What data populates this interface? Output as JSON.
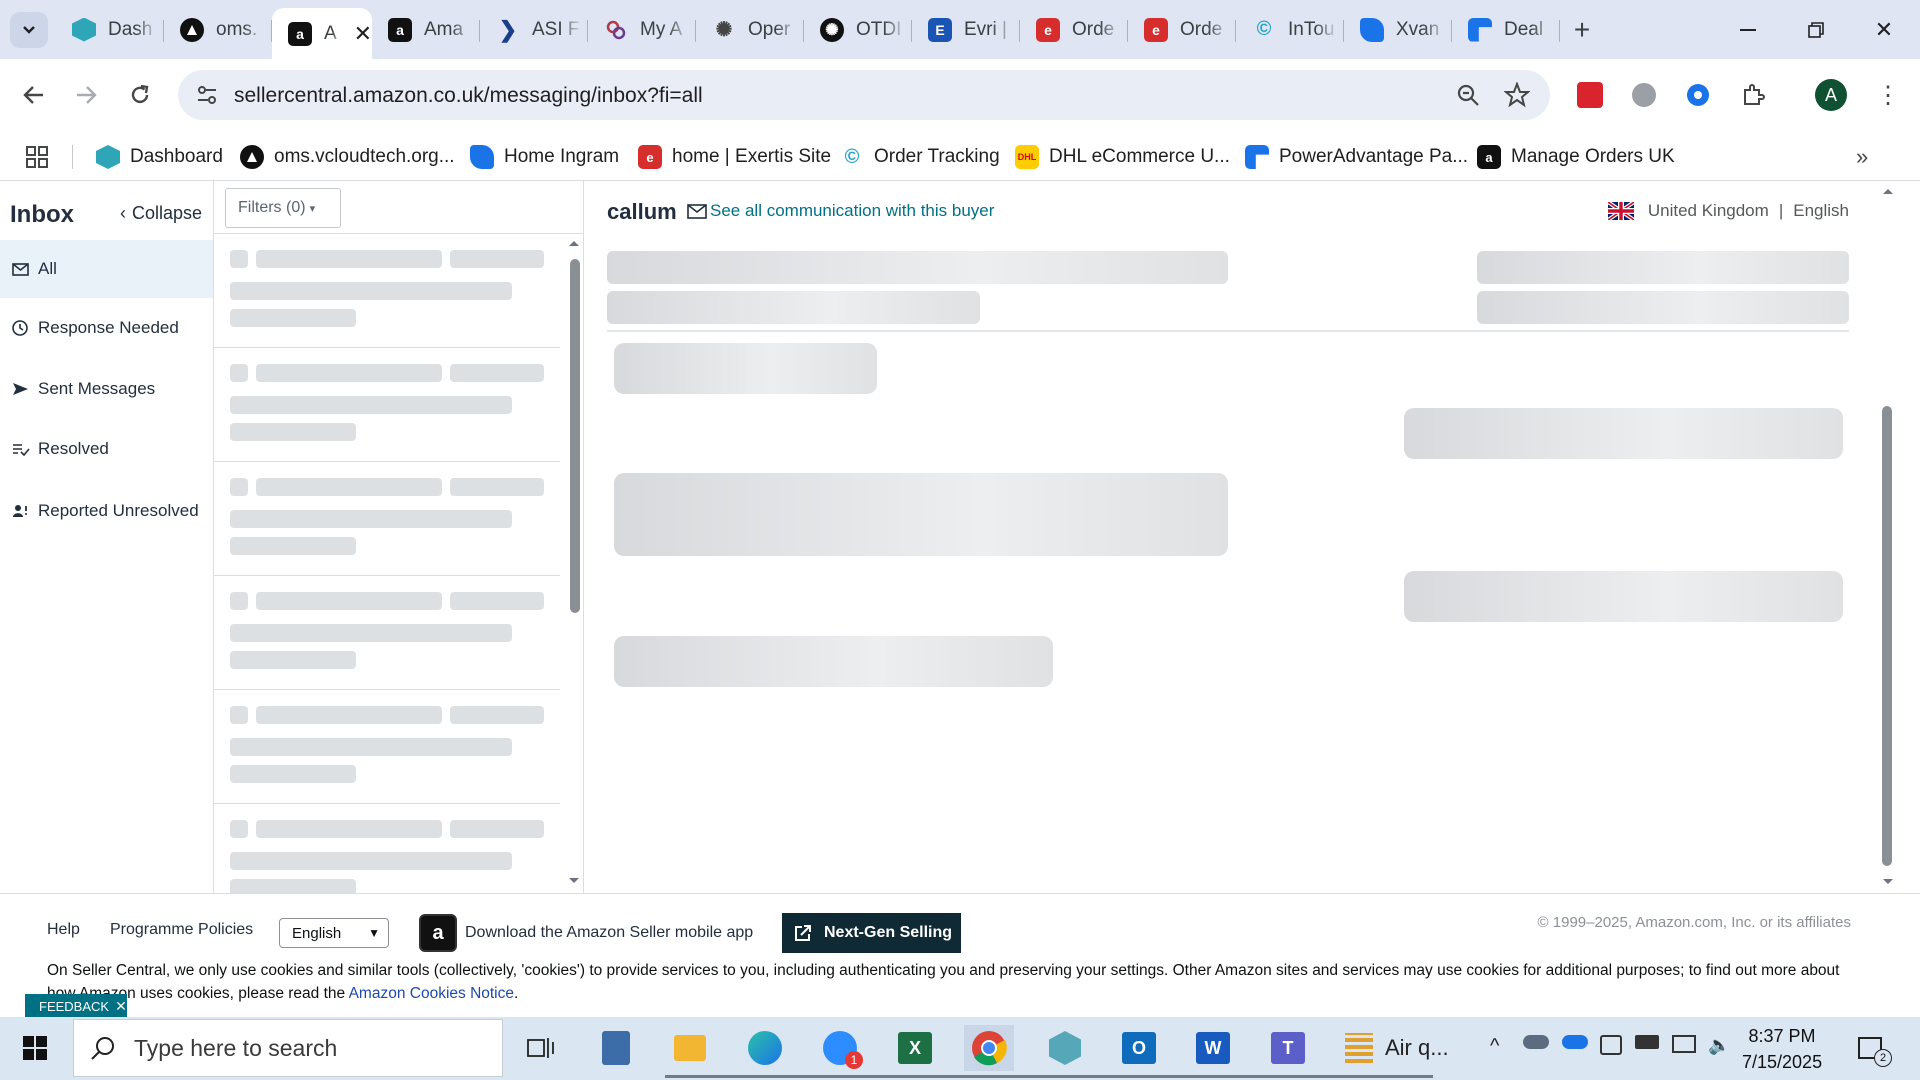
{
  "browser": {
    "tabs": [
      {
        "title": "Dash",
        "icon": "hexagon-icon",
        "color": "#2fa5b8"
      },
      {
        "title": "oms.",
        "icon": "triangle-logo-icon",
        "color": "#111111"
      },
      {
        "title": "A",
        "icon": "amazon-icon",
        "color": "#111111",
        "active": true
      },
      {
        "title": "Ama",
        "icon": "amazon-icon",
        "color": "#111111"
      },
      {
        "title": "ASI F",
        "icon": "chevron-right-logo-icon",
        "color": "#1a3e8c"
      },
      {
        "title": "My A",
        "icon": "circles-logo-icon",
        "color": "#b03a4a"
      },
      {
        "title": "Oper",
        "icon": "openai-icon",
        "color": "#444444"
      },
      {
        "title": "OTDI",
        "icon": "openai-icon",
        "color": "#111111"
      },
      {
        "title": "Evri |",
        "icon": "evri-icon",
        "color": "#1a55b3"
      },
      {
        "title": "Orde",
        "icon": "exertis-icon",
        "color": "#d62d2d"
      },
      {
        "title": "Orde",
        "icon": "exertis-icon",
        "color": "#d62d2d"
      },
      {
        "title": "InTou",
        "icon": "c-logo-icon",
        "color": "#22a6c9"
      },
      {
        "title": "Xvan",
        "icon": "ingram-icon",
        "color": "#1b73e8"
      },
      {
        "title": "Deal",
        "icon": "bookmark-blue-icon",
        "color": "#1b73e8"
      }
    ],
    "url": "sellercentral.amazon.co.uk/messaging/inbox?fi=all",
    "profile_initial": "A",
    "bookmarks": [
      {
        "label": "Dashboard",
        "icon": "hexagon-icon",
        "color": "#2fa5b8"
      },
      {
        "label": "oms.vcloudtech.org...",
        "icon": "triangle-logo-icon",
        "color": "#111111"
      },
      {
        "label": "Home Ingram",
        "icon": "ingram-icon",
        "color": "#1b73e8"
      },
      {
        "label": "home | Exertis Site",
        "icon": "exertis-icon",
        "color": "#d62d2d"
      },
      {
        "label": "Order Tracking",
        "icon": "c-logo-icon",
        "color": "#22a6c9"
      },
      {
        "label": "DHL eCommerce U...",
        "icon": "dhl-icon",
        "color": "#ffcc00"
      },
      {
        "label": "PowerAdvantage Pa...",
        "icon": "bookmark-blue-icon",
        "color": "#1b73e8"
      },
      {
        "label": "Manage Orders UK",
        "icon": "amazon-icon",
        "color": "#111111"
      }
    ]
  },
  "sidebar": {
    "title": "Inbox",
    "collapse_label": "Collapse",
    "items": [
      {
        "label": "All",
        "icon": "mail-icon",
        "active": true
      },
      {
        "label": "Response Needed",
        "icon": "clock-icon"
      },
      {
        "label": "Sent Messages",
        "icon": "send-icon"
      },
      {
        "label": "Resolved",
        "icon": "resolved-icon"
      },
      {
        "label": "Reported Unresolved",
        "icon": "reported-icon"
      }
    ]
  },
  "list": {
    "filters_label": "Filters (0)"
  },
  "conversation": {
    "buyer_name": "callum",
    "see_all_label": "See all communication with this buyer",
    "country": "United Kingdom",
    "separator": "|",
    "language": "English"
  },
  "footer": {
    "help": "Help",
    "policies": "Programme Policies",
    "language_value": "English",
    "app_download": "Download the Amazon Seller mobile app",
    "next_gen": "Next-Gen Selling",
    "copyright": "© 1999–2025, Amazon.com, Inc. or its affiliates",
    "cookie_text": "On Seller Central, we only use cookies and similar tools (collectively, 'cookies') to provide services to you, including authenticating you and preserving your settings. Other Amazon sites and services may use cookies for additional purposes; to find out more about how Amazon uses cookies, please read the",
    "cookie_link": "Amazon Cookies Notice",
    "cookie_end": ".",
    "feedback": "FEEDBACK"
  },
  "taskbar": {
    "search_placeholder": "Type here to search",
    "zoom_badge": "1",
    "air_label": "Air q...",
    "time": "8:37 PM",
    "date": "7/15/2025",
    "notification_count": "2"
  },
  "colors": {
    "link": "#007185",
    "active_folder_bg": "#e8f2f8",
    "next_gen_bg": "#0f2a35"
  }
}
